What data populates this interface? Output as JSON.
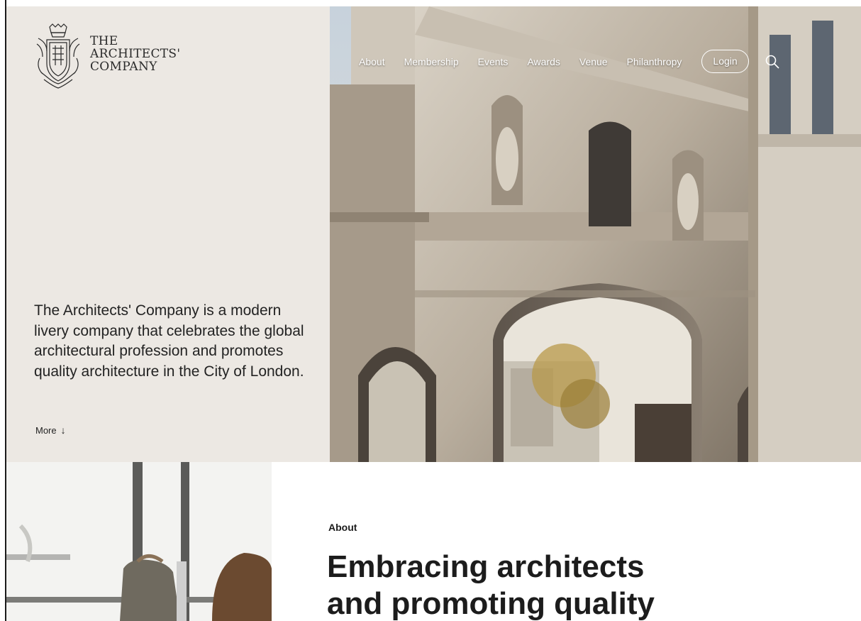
{
  "brand": {
    "logo_lines": [
      "THE",
      "ARCHITECTS'",
      "COMPANY"
    ],
    "crest_icon": "heraldic-crest-icon"
  },
  "nav": {
    "items": [
      "About",
      "Membership",
      "Events",
      "Awards",
      "Venue",
      "Philanthropy"
    ],
    "login_label": "Login",
    "search_icon": "search-icon"
  },
  "hero": {
    "intro": "The Architects' Company is a modern livery company that celebrates the global architectural profession and promotes quality architecture in the City of London.",
    "more_label": "More",
    "more_icon": "arrow-down-icon"
  },
  "about": {
    "label": "About",
    "heading_lines": [
      "Embracing architects",
      "and promoting quality"
    ]
  },
  "colors": {
    "panel_bg": "#ece8e3",
    "text": "#1c1c1c",
    "nav_text": "#ffffff"
  }
}
